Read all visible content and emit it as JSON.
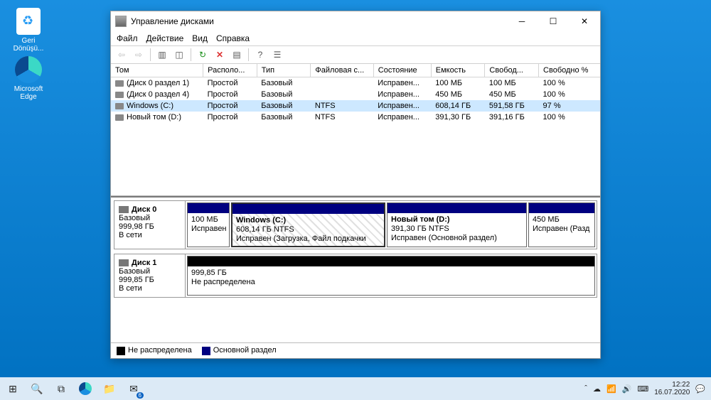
{
  "desktop": {
    "recycle": "Geri Dönüşü...",
    "edge": "Microsoft Edge"
  },
  "taskbar": {
    "time": "12:22",
    "date": "16.07.2020",
    "mail_badge": "6"
  },
  "window": {
    "title": "Управление дисками"
  },
  "menu": {
    "file": "Файл",
    "action": "Действие",
    "view": "Вид",
    "help": "Справка"
  },
  "columns": {
    "tom": "Том",
    "layout": "Располо...",
    "type": "Тип",
    "fs": "Файловая с...",
    "status": "Состояние",
    "capacity": "Емкость",
    "free": "Свобод...",
    "freepct": "Свободно %"
  },
  "rows": [
    {
      "name": "(Диск 0 раздел 1)",
      "layout": "Простой",
      "type": "Базовый",
      "fs": "",
      "status": "Исправен...",
      "cap": "100 МБ",
      "free": "100 МБ",
      "pct": "100 %"
    },
    {
      "name": "(Диск 0 раздел 4)",
      "layout": "Простой",
      "type": "Базовый",
      "fs": "",
      "status": "Исправен...",
      "cap": "450 МБ",
      "free": "450 МБ",
      "pct": "100 %"
    },
    {
      "name": "Windows (C:)",
      "layout": "Простой",
      "type": "Базовый",
      "fs": "NTFS",
      "status": "Исправен...",
      "cap": "608,14 ГБ",
      "free": "591,58 ГБ",
      "pct": "97 %"
    },
    {
      "name": "Новый том (D:)",
      "layout": "Простой",
      "type": "Базовый",
      "fs": "NTFS",
      "status": "Исправен...",
      "cap": "391,30 ГБ",
      "free": "391,16 ГБ",
      "pct": "100 %"
    }
  ],
  "disks": {
    "d0": {
      "name": "Диск 0",
      "type": "Базовый",
      "size": "999,98 ГБ",
      "status": "В сети"
    },
    "d1": {
      "name": "Диск 1",
      "type": "Базовый",
      "size": "999,85 ГБ",
      "status": "В сети"
    }
  },
  "parts": {
    "p0": {
      "size": "100 МБ",
      "status": "Исправен"
    },
    "p1": {
      "name": "Windows  (C:)",
      "size": "608,14 ГБ NTFS",
      "status": "Исправен (Загрузка, Файл подкачки"
    },
    "p2": {
      "name": "Новый том  (D:)",
      "size": "391,30 ГБ NTFS",
      "status": "Исправен (Основной раздел)"
    },
    "p3": {
      "size": "450 МБ",
      "status": "Исправен (Разд"
    },
    "u1": {
      "size": "999,85 ГБ",
      "status": "Не распределена"
    }
  },
  "legend": {
    "unalloc": "Не распределена",
    "primary": "Основной раздел"
  }
}
